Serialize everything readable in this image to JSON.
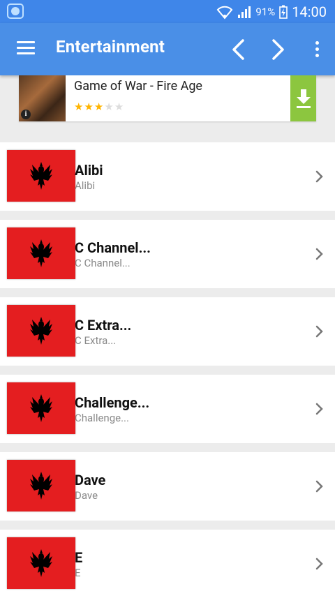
{
  "status": {
    "battery_percent": "91%",
    "time": "14:00"
  },
  "toolbar": {
    "title": "Entertainment"
  },
  "ad": {
    "title": "Game of War - Fire Age",
    "rating": 3,
    "rating_max": 5,
    "info_badge": "i"
  },
  "channels": [
    {
      "name": "Alibi",
      "subtitle": "Alibi"
    },
    {
      "name": "C Channel...",
      "subtitle": "C Channel..."
    },
    {
      "name": "C Extra...",
      "subtitle": "C Extra..."
    },
    {
      "name": "Challenge...",
      "subtitle": "Challenge..."
    },
    {
      "name": "Dave",
      "subtitle": "Dave"
    },
    {
      "name": "E",
      "subtitle": "E"
    }
  ],
  "colors": {
    "primary": "#4a8fe7",
    "status_bar": "#3f86e9",
    "flag_red": "#e41e20",
    "download_green": "#8cc63f"
  },
  "icons": [
    "menu-icon",
    "back-icon",
    "forward-icon",
    "more-icon",
    "download-icon",
    "chevron-right-icon",
    "eagle-flag-icon"
  ]
}
